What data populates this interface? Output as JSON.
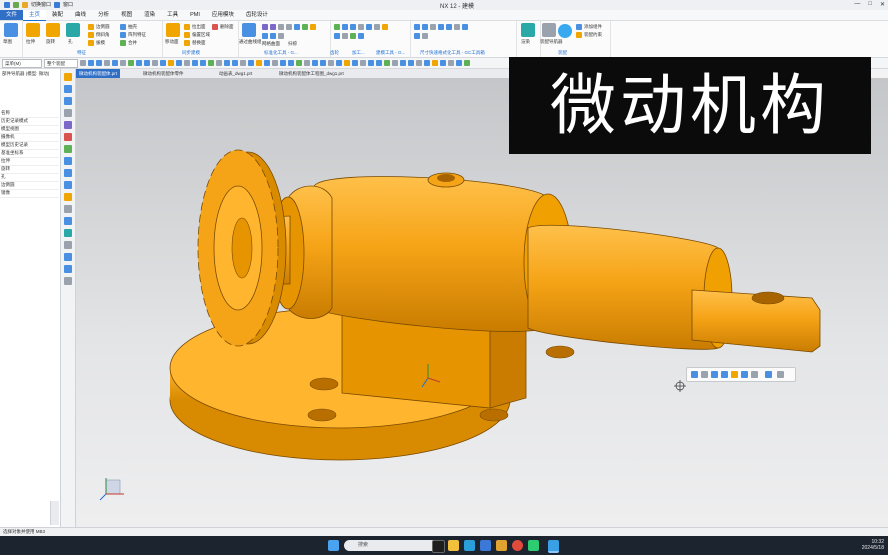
{
  "window": {
    "title": "NX 12 - 建模",
    "quick_access_label": "切换窗口",
    "window_menu": "窗口",
    "controls": [
      "—",
      "□",
      "✕"
    ]
  },
  "menu": {
    "tabs": [
      "文件",
      "主页",
      "装配",
      "曲线",
      "分析",
      "视图",
      "渲染",
      "工具",
      "PMI",
      "应用模块",
      "齿轮设计"
    ],
    "active_index": 1,
    "search_placeholder": "查找命令"
  },
  "ribbon": {
    "groups": [
      {
        "name": "直接草图",
        "items": [
          "草图"
        ]
      },
      {
        "name": "特征",
        "items": [
          "拉伸",
          "旋转",
          "孔",
          "边倒圆",
          "倒斜角",
          "拔模",
          "抽壳",
          "阵列特征",
          "合并",
          "减去"
        ]
      },
      {
        "name": "同步建模",
        "items": [
          "移动面",
          "拉出面",
          "偏置区域",
          "替换面",
          "删除面"
        ]
      },
      {
        "name": "曲面",
        "items": [
          "通过曲线组",
          "网格曲面",
          "扫掠"
        ]
      },
      {
        "name": "标准化工具 - G...",
        "items": []
      },
      {
        "name": "齿轮",
        "items": []
      },
      {
        "name": "加工...",
        "items": []
      },
      {
        "name": "建模工具 - G...",
        "items": []
      },
      {
        "name": "尺寸快速格式化工具 - GC工具箱",
        "items": []
      },
      {
        "name": "渲染",
        "items": [
          "渲染"
        ]
      },
      {
        "name": "装配",
        "items": [
          "装配导航器",
          "添加组件",
          "装配约束"
        ]
      }
    ],
    "side_items": [
      "草图",
      "基准平面",
      "更多"
    ]
  },
  "selection_bar": {
    "menu_label": "菜单(M)",
    "filter_value": "整个装配",
    "type_value": "无选择过滤器"
  },
  "navigator": {
    "title": "部件导航器 (模型: 微动)",
    "rows": [
      "名称",
      "历史记录模式",
      "模型视图",
      "摄像机",
      "模型历史记录",
      "基准坐标系",
      "拉伸",
      "旋转",
      "孔",
      "边倒圆",
      "镜像"
    ]
  },
  "doc_tabs": [
    {
      "label": "微动机构装配体.prt",
      "active": true
    },
    {
      "label": "微动机构装配体零件",
      "active": false
    },
    {
      "label": "动画表_dwg1.prt",
      "active": false
    },
    {
      "label": "微动机构装配体工程图_dwg1.prt",
      "active": false
    }
  ],
  "caption": {
    "text": "微动机构"
  },
  "status": {
    "text": "选择对象并使用 MB3"
  },
  "taskbar": {
    "search_placeholder": "搜索",
    "time": "10:32",
    "date": "2024/5/18"
  },
  "colors": {
    "part": "#f6a417",
    "part_dark": "#c97c00",
    "ribbon_accent": "#1f6fd0",
    "caption_bg": "#0b0b0b"
  }
}
